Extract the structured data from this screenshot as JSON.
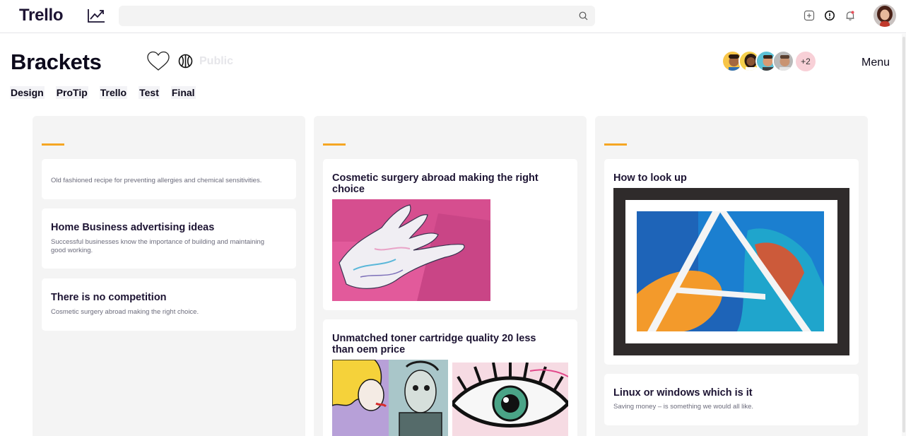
{
  "app": {
    "logo": "Trello"
  },
  "search": {
    "value": "",
    "placeholder": ""
  },
  "board": {
    "title": "Brackets",
    "visibility": "Public",
    "members_extra": "+2",
    "menu_label": "Menu",
    "tags": [
      "Design",
      "ProTip",
      "Trello",
      "Test",
      "Final"
    ]
  },
  "columns": [
    {
      "cards": [
        {
          "title": "",
          "desc": "Old fashioned recipe for preventing allergies and chemical sensitivities."
        },
        {
          "title": "Home Business advertising ideas",
          "desc": "Successful businesses know the importance of building and maintaining good working."
        },
        {
          "title": "There is no competition",
          "desc": "Cosmetic surgery abroad making the right choice."
        }
      ]
    },
    {
      "cards": [
        {
          "title": "Cosmetic surgery abroad making the right choice"
        },
        {
          "title": "Unmatched toner cartridge quality 20 less than oem price"
        }
      ]
    },
    {
      "cards": [
        {
          "title": "How to look up"
        },
        {
          "title": "Linux or windows which is it",
          "desc": "Saving money – is something we would all like."
        }
      ]
    }
  ],
  "colors": {
    "accent": "#f5a623",
    "column_bg": "#f4f4f4",
    "title_text": "#1d1433",
    "member_more_bg": "#f8d0d7"
  },
  "icons": [
    "trending-up-icon",
    "search-icon",
    "add-square-icon",
    "info-icon",
    "bell-icon",
    "heart-icon",
    "basketball-icon"
  ]
}
